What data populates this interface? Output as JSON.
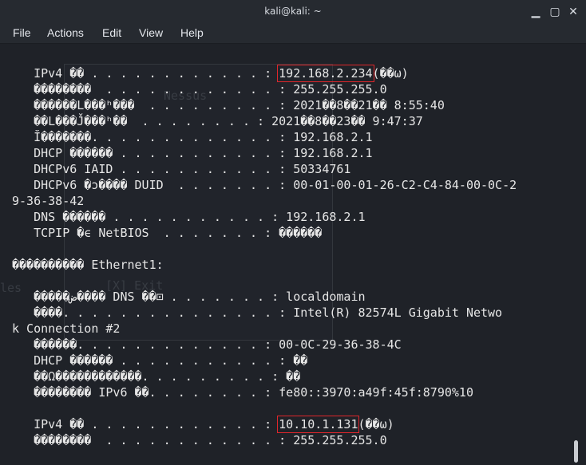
{
  "window": {
    "title": "kali@kali: ~",
    "controls": {
      "minimize": "▁",
      "maximize": "▢",
      "close": "✕"
    }
  },
  "menu": {
    "file": "File",
    "actions": "Actions",
    "edit": "Edit",
    "view": "View",
    "help": "Help"
  },
  "background_ghost": {
    "text1": "Nessus",
    "text2": "[X] Exit",
    "text3": "les"
  },
  "terminal": {
    "lines": [
      {
        "pre": "   IPv4 �� . . . . . . . . . . . . : ",
        "hl": "192.168.2.234",
        "post": "(��ω)"
      },
      {
        "pre": "   ��������  . . . . . . . . . . . . : 255.255.255.0"
      },
      {
        "pre": "   ������L���ʰ���  . . . . . . . . . : 2021��8��21�� 8:55:40"
      },
      {
        "pre": "   ��L���J̌���ʰ��  . . . . . . . . : 2021��8��23�� 9:47:37"
      },
      {
        "pre": "   Ĭ�������. . . . . . . . . . . . . : 192.168.2.1"
      },
      {
        "pre": "   DHCP ������ . . . . . . . . . . . : 192.168.2.1"
      },
      {
        "pre": "   DHCPv6 IAID . . . . . . . . . . . : 50334761"
      },
      {
        "pre": "   DHCPv6 �ɔ���� DUID  . . . . . . . : 00-01-00-01-26-C2-C4-84-00-0C-2"
      },
      {
        "pre": "9-36-38-42"
      },
      {
        "pre": "   DNS ������ . . . . . . . . . . . : 192.168.2.1"
      },
      {
        "pre": "   TCPIP �ϵ NetBIOS  . . . . . . . : ������"
      },
      {
        "pre": ""
      },
      {
        "pre": "���������� Ethernet1:"
      },
      {
        "pre": ""
      },
      {
        "pre": "   �����ض���� DNS ��⊡ . . . . . . . : localdomain"
      },
      {
        "pre": "   ����. . . . . . . . . . . . . . . : Intel(R) 82574L Gigabit Netwo"
      },
      {
        "pre": "k Connection #2"
      },
      {
        "pre": "   ������. . . . . . . . . . . . . : 00-0C-29-36-38-4C"
      },
      {
        "pre": "   DHCP ������ . . . . . . . . . . . : ��"
      },
      {
        "pre": "   ��Ω������������. . . . . . . . . : ��"
      },
      {
        "pre": "   �������� IPv6 ��. . . . . . . . : fe80::3970:a49f:45f:8790%10"
      },
      {
        "pre": ""
      },
      {
        "pre": "   IPv4 �� . . . . . . . . . . . . : ",
        "hl": "10.10.1.131",
        "post": "(��ω)"
      },
      {
        "pre": "   ��������  . . . . . . . . . . . . : 255.255.255.0"
      }
    ]
  }
}
